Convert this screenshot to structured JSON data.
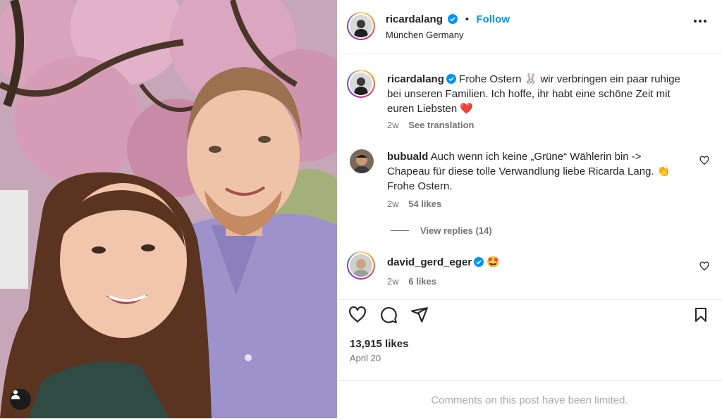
{
  "post": {
    "author": "ricardalang",
    "follow_label": "Follow",
    "dot": "•",
    "location": "München Germany"
  },
  "caption": {
    "username": "ricardalang",
    "text_part1": "Frohe Ostern",
    "bunny": "🐰",
    "text_part2": " wir verbringen ein paar ruhige bei unseren Familien. Ich hoffe, ihr habt eine schöne Zeit mit euren Liebsten ",
    "heart": "❤️",
    "time": "2w",
    "see_translation": "See translation"
  },
  "comments": [
    {
      "username": "bubuald",
      "text": "Auch wenn ich keine „Grüne“ Wählerin bin -> Chapeau für diese tolle Verwandlung liebe Ricarda Lang. 👏 Frohe Ostern.",
      "time": "2w",
      "likes": "54 likes",
      "view_replies": "View replies (14)"
    },
    {
      "username": "david_gerd_eger",
      "text": "🤩",
      "time": "2w",
      "likes": "6 likes"
    }
  ],
  "stats": {
    "likes": "13,915 likes",
    "date": "April 20"
  },
  "footer": {
    "limited": "Comments on this post have been limited."
  },
  "colors": {
    "accent": "#0095f6",
    "verified": "#0095f6",
    "text": "#262626",
    "muted": "#737373",
    "heart": "#ed4956"
  },
  "icons": [
    "heart-icon",
    "comment-icon",
    "share-icon",
    "bookmark-icon",
    "verified-icon",
    "more-options-icon",
    "user-tag-icon"
  ]
}
